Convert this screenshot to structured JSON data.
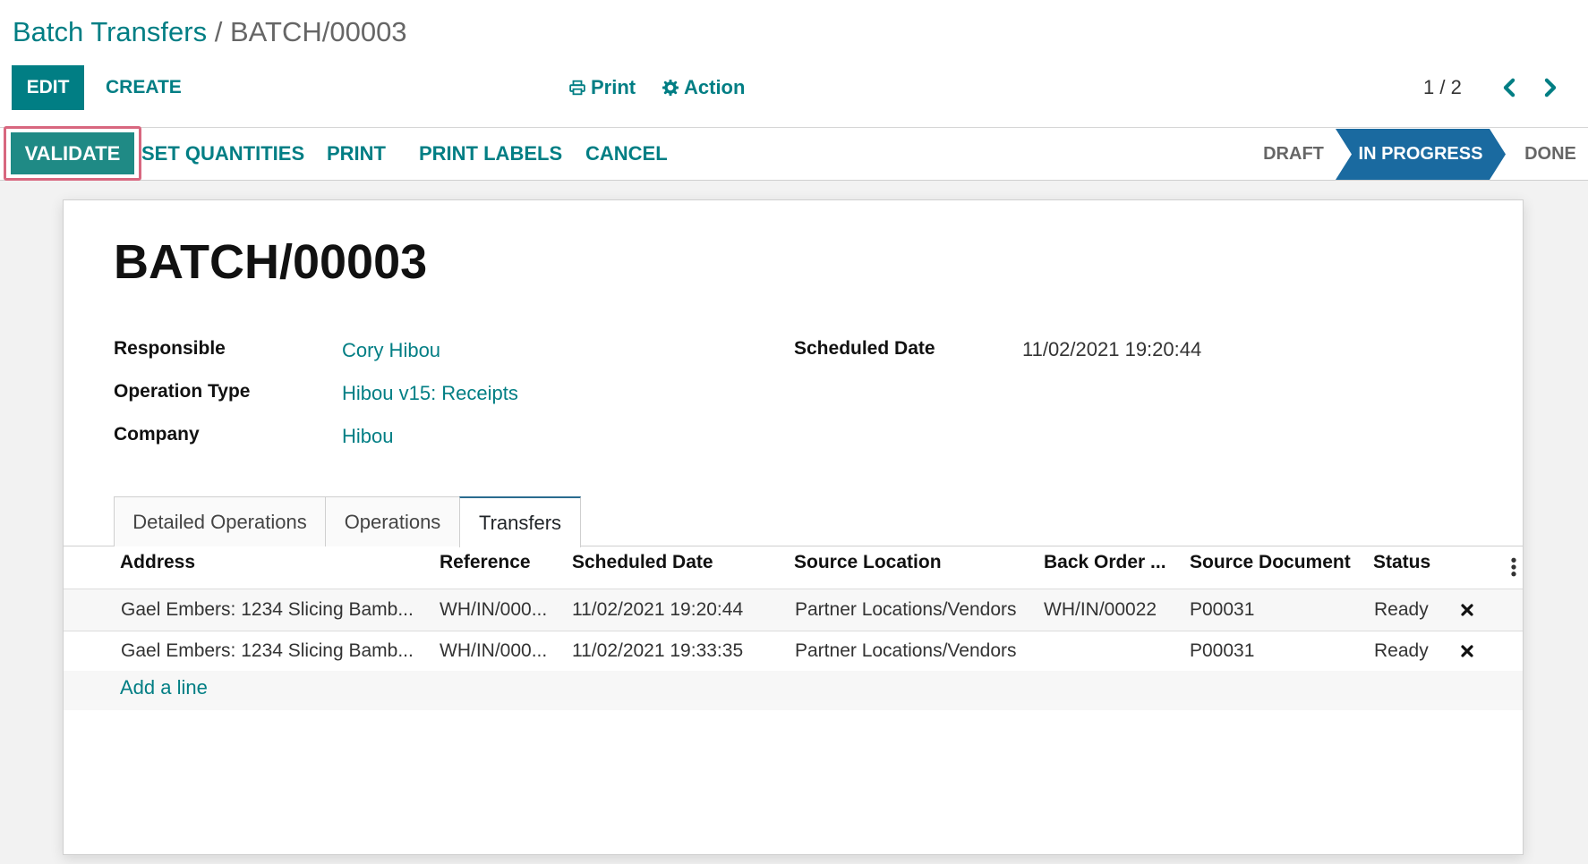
{
  "breadcrumb": {
    "parent": "Batch Transfers",
    "separator": "/",
    "current": "BATCH/00003"
  },
  "toolbar": {
    "edit_label": "EDIT",
    "create_label": "CREATE",
    "print_label": "Print",
    "action_label": "Action",
    "pager": "1 / 2"
  },
  "statusbar": {
    "buttons": {
      "validate": "VALIDATE",
      "set_quantities": "SET QUANTITIES",
      "print": "PRINT",
      "print_labels": "PRINT LABELS",
      "cancel": "CANCEL"
    },
    "stages": {
      "draft": "DRAFT",
      "in_progress": "IN PROGRESS",
      "done": "DONE"
    },
    "active_stage": "IN PROGRESS",
    "active_color": "#1a6aa0"
  },
  "record": {
    "title": "BATCH/00003",
    "fields": {
      "responsible_label": "Responsible",
      "responsible_value": "Cory Hibou",
      "operation_type_label": "Operation Type",
      "operation_type_value": "Hibou v15: Receipts",
      "company_label": "Company",
      "company_value": "Hibou",
      "scheduled_date_label": "Scheduled Date",
      "scheduled_date_value": "11/02/2021 19:20:44"
    }
  },
  "tabs": {
    "detailed_operations": "Detailed Operations",
    "operations": "Operations",
    "transfers": "Transfers",
    "active": "Transfers"
  },
  "table": {
    "headers": {
      "address": "Address",
      "reference": "Reference",
      "scheduled_date": "Scheduled Date",
      "source_location": "Source Location",
      "back_order": "Back Order ...",
      "source_document": "Source Document",
      "status": "Status"
    },
    "rows": [
      {
        "address": "Gael Embers: 1234 Slicing Bamb...",
        "reference": "WH/IN/000...",
        "scheduled_date": "11/02/2021 19:20:44",
        "source_location": "Partner Locations/Vendors",
        "back_order": "WH/IN/00022",
        "source_document": "P00031",
        "status": "Ready"
      },
      {
        "address": "Gael Embers: 1234 Slicing Bamb...",
        "reference": "WH/IN/000...",
        "scheduled_date": "11/02/2021 19:33:35",
        "source_location": "Partner Locations/Vendors",
        "back_order": "",
        "source_document": "P00031",
        "status": "Ready"
      }
    ],
    "add_line_label": "Add a line"
  },
  "colors": {
    "brand": "#017e84",
    "validate": "#1f8a85",
    "highlight": "#d8677f"
  },
  "icons": [
    "print-icon",
    "gear-icon",
    "chevron-left-icon",
    "chevron-right-icon",
    "kebab-icon",
    "delete-icon"
  ]
}
